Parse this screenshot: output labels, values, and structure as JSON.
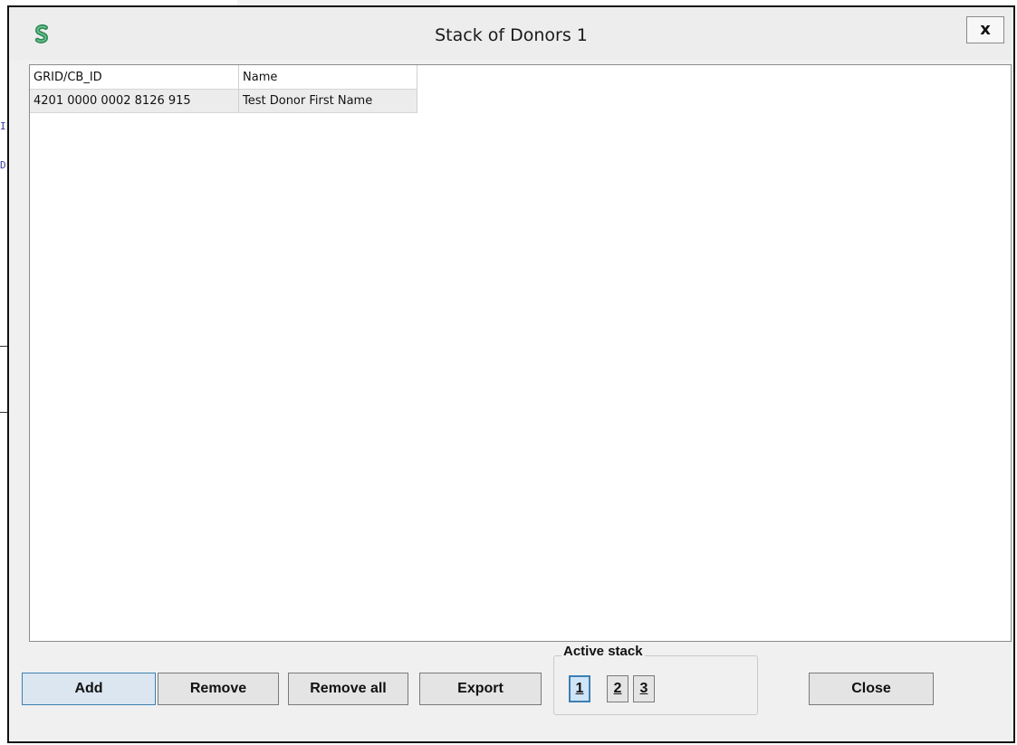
{
  "dialog": {
    "title": "Stack of Donors 1",
    "close_label": "x"
  },
  "table": {
    "columns": [
      "GRID/CB_ID",
      "Name"
    ],
    "rows": [
      [
        "4201 0000 0002 8126 915",
        "Test Donor First Name"
      ]
    ]
  },
  "buttons": {
    "add": "Add",
    "remove": "Remove",
    "remove_all": "Remove all",
    "export": "Export",
    "close": "Close"
  },
  "active_stack": {
    "label": "Active stack",
    "options": [
      "1",
      "2",
      "3"
    ],
    "selected": "1"
  },
  "background": {
    "glyphs": [
      "I",
      "D:"
    ]
  },
  "colors": {
    "accent": "#3c7fb1",
    "icon_green": "#2e8b57"
  }
}
